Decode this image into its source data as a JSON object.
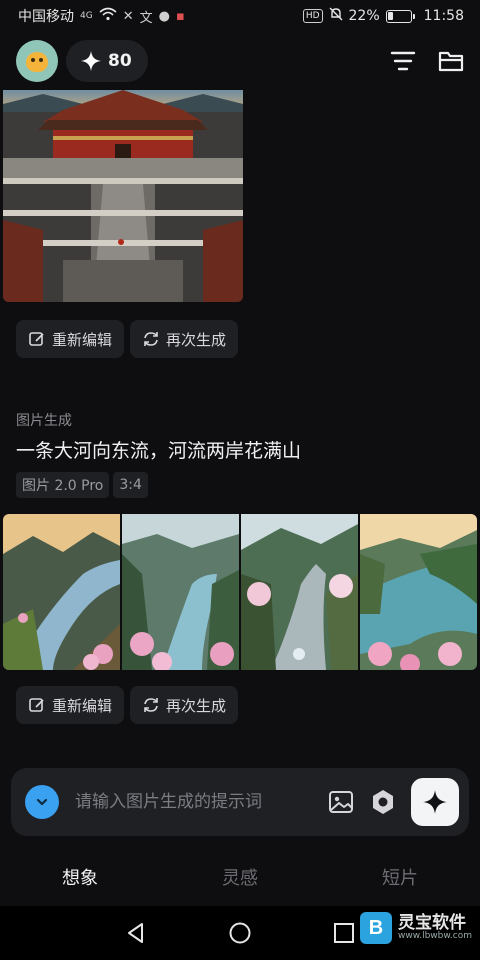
{
  "status_bar": {
    "carrier": "中国移动",
    "network": "4G",
    "hd": "HD",
    "battery": "22%",
    "battery_level": 0.22,
    "time": "11:58"
  },
  "header": {
    "credits": "80",
    "icons": [
      "avatar",
      "sparkle-icon",
      "filter-icon",
      "folder-icon"
    ]
  },
  "feed": {
    "top_actions": {
      "edit_label": "重新编辑",
      "regenerate_label": "再次生成"
    },
    "entry": {
      "section_label": "图片生成",
      "prompt": "一条大河向东流，河流两岸花满山",
      "model_tag": "图片 2.0 Pro",
      "ratio_tag": "3:4"
    },
    "bottom_actions": {
      "edit_label": "重新编辑",
      "regenerate_label": "再次生成"
    }
  },
  "input": {
    "placeholder": "请输入图片生成的提示词",
    "value": ""
  },
  "tabs": [
    {
      "label": "想象",
      "active": true
    },
    {
      "label": "灵感",
      "active": false
    },
    {
      "label": "短片",
      "active": false
    }
  ],
  "watermark": {
    "name": "灵宝软件",
    "url": "www.lbwbw.com",
    "logo_letter": "B"
  },
  "colors": {
    "accent": "#3aa0f0",
    "background": "#0e0e10",
    "card": "#1f2024"
  }
}
